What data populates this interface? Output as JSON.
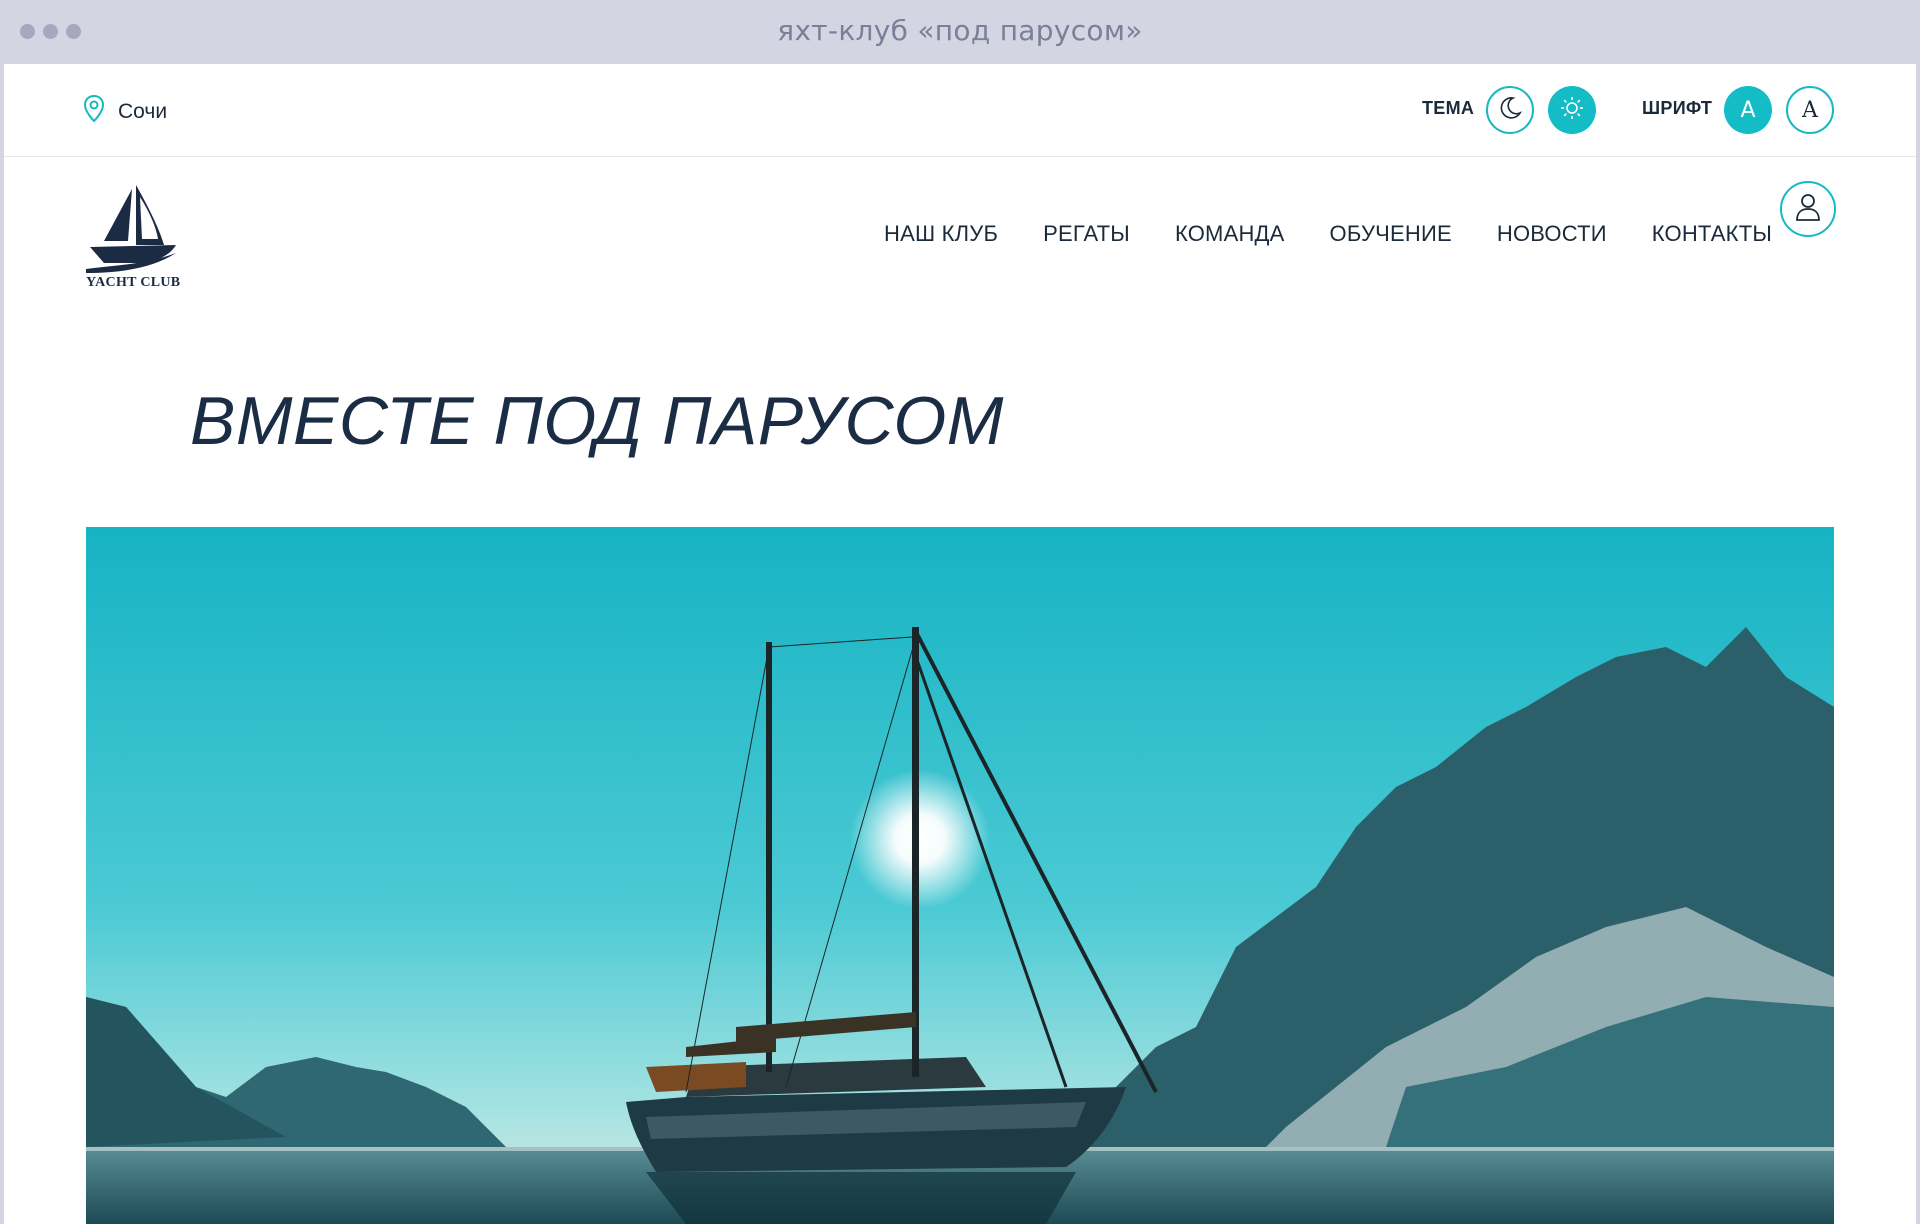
{
  "window": {
    "title": "яхт-клуб «под парусом»"
  },
  "topbar": {
    "city": "Сочи",
    "theme_label": "ТЕМА",
    "font_label": "ШРИФТ",
    "font_sans_letter": "A",
    "font_serif_letter": "A"
  },
  "logo": {
    "text": "YACHT CLUB"
  },
  "nav": {
    "items": [
      "НАШ КЛУБ",
      "РЕГАТЫ",
      "КОМАНДА",
      "ОБУЧЕНИЕ",
      "НОВОСТИ",
      "КОНТАКТЫ"
    ]
  },
  "hero": {
    "title": "ВМЕСТЕ ПОД ПАРУСОМ"
  },
  "icons": {
    "location": "location-pin-icon",
    "dark_theme": "moon-icon",
    "light_theme": "sun-icon",
    "account": "user-icon"
  },
  "colors": {
    "accent": "#14bcc6",
    "text": "#1b2a3a",
    "frame": "#d3d5e2"
  }
}
